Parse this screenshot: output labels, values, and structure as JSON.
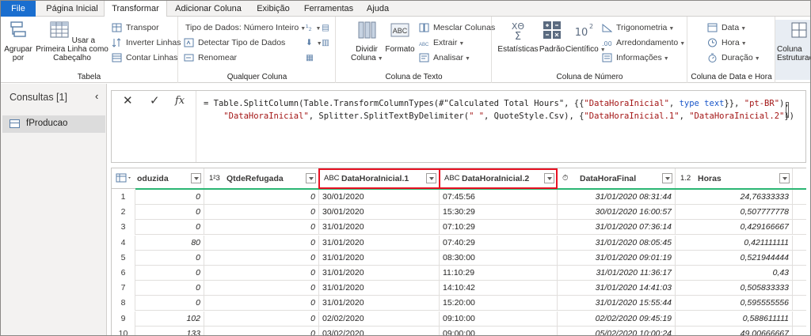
{
  "tabs": [
    "File",
    "Página Inicial",
    "Transformar",
    "Adicionar Coluna",
    "Exibição",
    "Ferramentas",
    "Ajuda"
  ],
  "active_tab": "Transformar",
  "ribbon": {
    "tabela": {
      "label": "Tabela",
      "agrupar": "Agrupar por",
      "usar_primeira": "Usar a Primeira Linha como Cabeçalho",
      "transpor": "Transpor",
      "inverter": "Inverter Linhas",
      "contar": "Contar Linhas"
    },
    "qualquer": {
      "label": "Qualquer Coluna",
      "tipo": "Tipo de Dados: Número Inteiro",
      "detectar": "Detectar Tipo de Dados",
      "renomear": "Renomear"
    },
    "texto": {
      "label": "Coluna de Texto",
      "dividir": "Dividir Coluna",
      "formato": "Formato",
      "mesclar": "Mesclar Colunas",
      "extrair": "Extrair",
      "analisar": "Analisar"
    },
    "numero": {
      "label": "Coluna de Número",
      "estatisticas": "Estatísticas",
      "padrao": "Padrão",
      "cientifico": "Científico",
      "trigonometria": "Trigonometria",
      "arredondamento": "Arredondamento",
      "informacoes": "Informações"
    },
    "data_hora": {
      "label": "Coluna de Data e Hora",
      "data": "Data",
      "hora": "Hora",
      "duracao": "Duração"
    },
    "estruturada": "Coluna Estruturada"
  },
  "queries": {
    "title": "Consultas [1]",
    "items": [
      "fProducao"
    ]
  },
  "formula": {
    "line1_a": "= Table.SplitColumn(Table.TransformColumnTypes(#\"Calculated Total Hours\", {{",
    "line1_s1": "\"DataHoraInicial\"",
    "line1_b": ", ",
    "line1_k": "type text",
    "line1_c": "}}, ",
    "line1_s2": "\"pt-BR\"",
    "line1_d": "),",
    "line2_s1": "\"DataHoraInicial\"",
    "line2_a": ", Splitter.SplitTextByDelimiter(",
    "line2_s2": "\" \"",
    "line2_b": ", QuoteStyle.Csv), {",
    "line2_s3": "\"DataHoraInicial.1\"",
    "line2_c": ", ",
    "line2_s4": "\"DataHoraInicial.2\"",
    "line2_d": "})"
  },
  "table": {
    "columns": [
      {
        "type": "",
        "name": "oduzida"
      },
      {
        "type": "1²3",
        "name": "QtdeRefugada"
      },
      {
        "type": "ABC",
        "name": "DataHoraInicial.1"
      },
      {
        "type": "ABC",
        "name": "DataHoraInicial.2"
      },
      {
        "type": "⏱",
        "name": "DataHoraFinal"
      },
      {
        "type": "1.2",
        "name": "Horas"
      }
    ],
    "rows": [
      [
        "1",
        "0",
        "0",
        "30/01/2020",
        "07:45:56",
        "31/01/2020 08:31:44",
        "24,76333333"
      ],
      [
        "2",
        "0",
        "0",
        "30/01/2020",
        "15:30:29",
        "30/01/2020 16:00:57",
        "0,507777778"
      ],
      [
        "3",
        "0",
        "0",
        "31/01/2020",
        "07:10:29",
        "31/01/2020 07:36:14",
        "0,429166667"
      ],
      [
        "4",
        "80",
        "0",
        "31/01/2020",
        "07:40:29",
        "31/01/2020 08:05:45",
        "0,421111111"
      ],
      [
        "5",
        "0",
        "0",
        "31/01/2020",
        "08:30:00",
        "31/01/2020 09:01:19",
        "0,521944444"
      ],
      [
        "6",
        "0",
        "0",
        "31/01/2020",
        "11:10:29",
        "31/01/2020 11:36:17",
        "0,43"
      ],
      [
        "7",
        "0",
        "0",
        "31/01/2020",
        "14:10:42",
        "31/01/2020 14:41:03",
        "0,505833333"
      ],
      [
        "8",
        "0",
        "0",
        "31/01/2020",
        "15:20:00",
        "31/01/2020 15:55:44",
        "0,595555556"
      ],
      [
        "9",
        "102",
        "0",
        "02/02/2020",
        "09:10:00",
        "02/02/2020 09:45:19",
        "0,588611111"
      ],
      [
        "10",
        "133",
        "0",
        "03/02/2020",
        "09:00:00",
        "05/02/2020 10:00:24",
        "49,00666667"
      ]
    ]
  }
}
